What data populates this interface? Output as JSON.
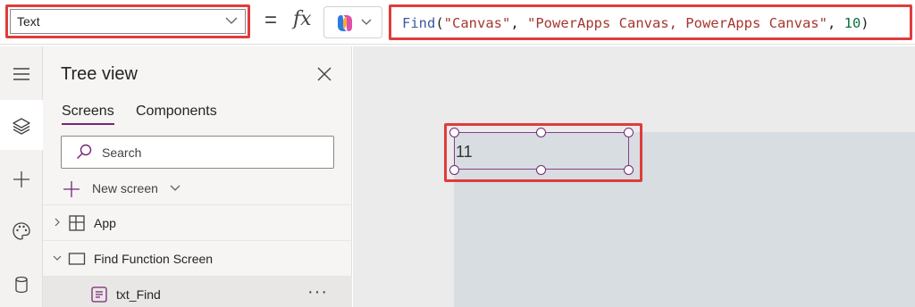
{
  "formula_bar": {
    "property_value": "Text",
    "equals": "=",
    "fx": "fx",
    "formula_tokens": [
      {
        "t": "Find",
        "k": "fn"
      },
      {
        "t": "(",
        "k": "p"
      },
      {
        "t": "\"Canvas\"",
        "k": "str"
      },
      {
        "t": ", ",
        "k": "p"
      },
      {
        "t": "\"PowerApps Canvas, PowerApps Canvas\"",
        "k": "str"
      },
      {
        "t": ", ",
        "k": "p"
      },
      {
        "t": "10",
        "k": "num"
      },
      {
        "t": ")",
        "k": "p"
      }
    ]
  },
  "rail": {
    "items": [
      {
        "icon": "hamburger-menu-icon"
      },
      {
        "icon": "layers-icon",
        "active": true
      },
      {
        "icon": "plus-icon"
      },
      {
        "icon": "palette-icon"
      },
      {
        "icon": "database-icon"
      }
    ]
  },
  "tree_view": {
    "title": "Tree view",
    "tabs": [
      "Screens",
      "Components"
    ],
    "search_placeholder": "Search",
    "new_screen_label": "New screen",
    "items": [
      {
        "label": "App",
        "icon": "app-grid-icon"
      },
      {
        "label": "Find Function Screen",
        "icon": "screen-icon"
      },
      {
        "label": "txt_Find",
        "icon": "text-label-icon",
        "selected": true,
        "more": "···"
      }
    ]
  },
  "canvas": {
    "control_value": "11"
  },
  "colors": {
    "accent": "#742774",
    "highlight": "#e03c3c",
    "canvas_bg": "#ebebeb",
    "screen_bg": "#d7dde1"
  }
}
